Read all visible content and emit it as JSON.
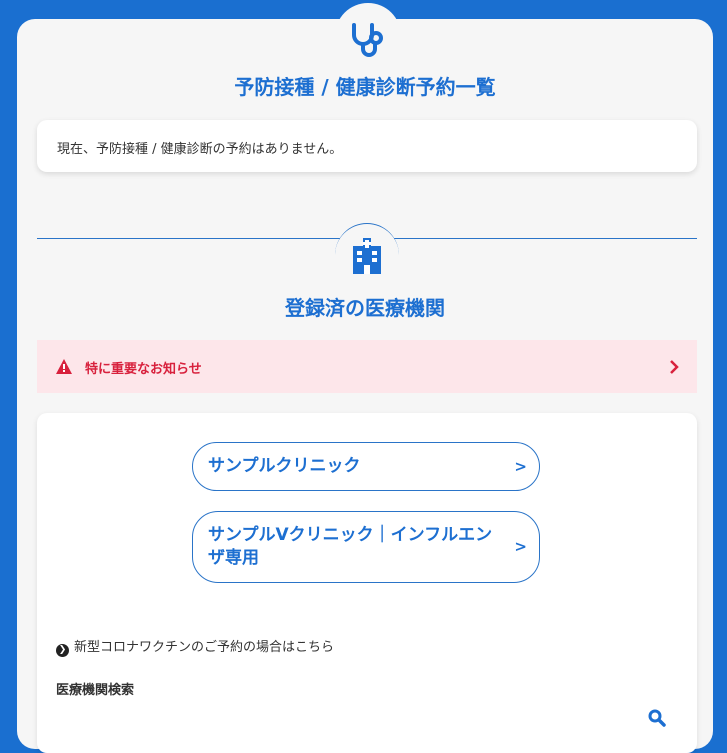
{
  "vaccination": {
    "title": "予防接種 / 健康診断予約一覧",
    "empty_message": "現在、予防接種 / 健康診断の予約はありません。",
    "icon": "stethoscope-icon"
  },
  "institutions": {
    "title": "登録済の医療機関",
    "icon": "hospital-icon",
    "alert": {
      "label": "特に重要なお知らせ",
      "icon": "warning-icon",
      "color": "#d8213d"
    },
    "clinics": [
      {
        "name": "サンプルクリニック",
        "arrow": ">"
      },
      {
        "name": "サンプルVクリニック｜インフルエンザ専用",
        "arrow": ">"
      }
    ],
    "corona_link": "新型コロナワクチンのご予約の場合はこちら",
    "search_label": "医療機関検索"
  },
  "colors": {
    "brand": "#1d6fd1",
    "background": "#1a6fd0",
    "alert_bg": "#fde6ea"
  }
}
